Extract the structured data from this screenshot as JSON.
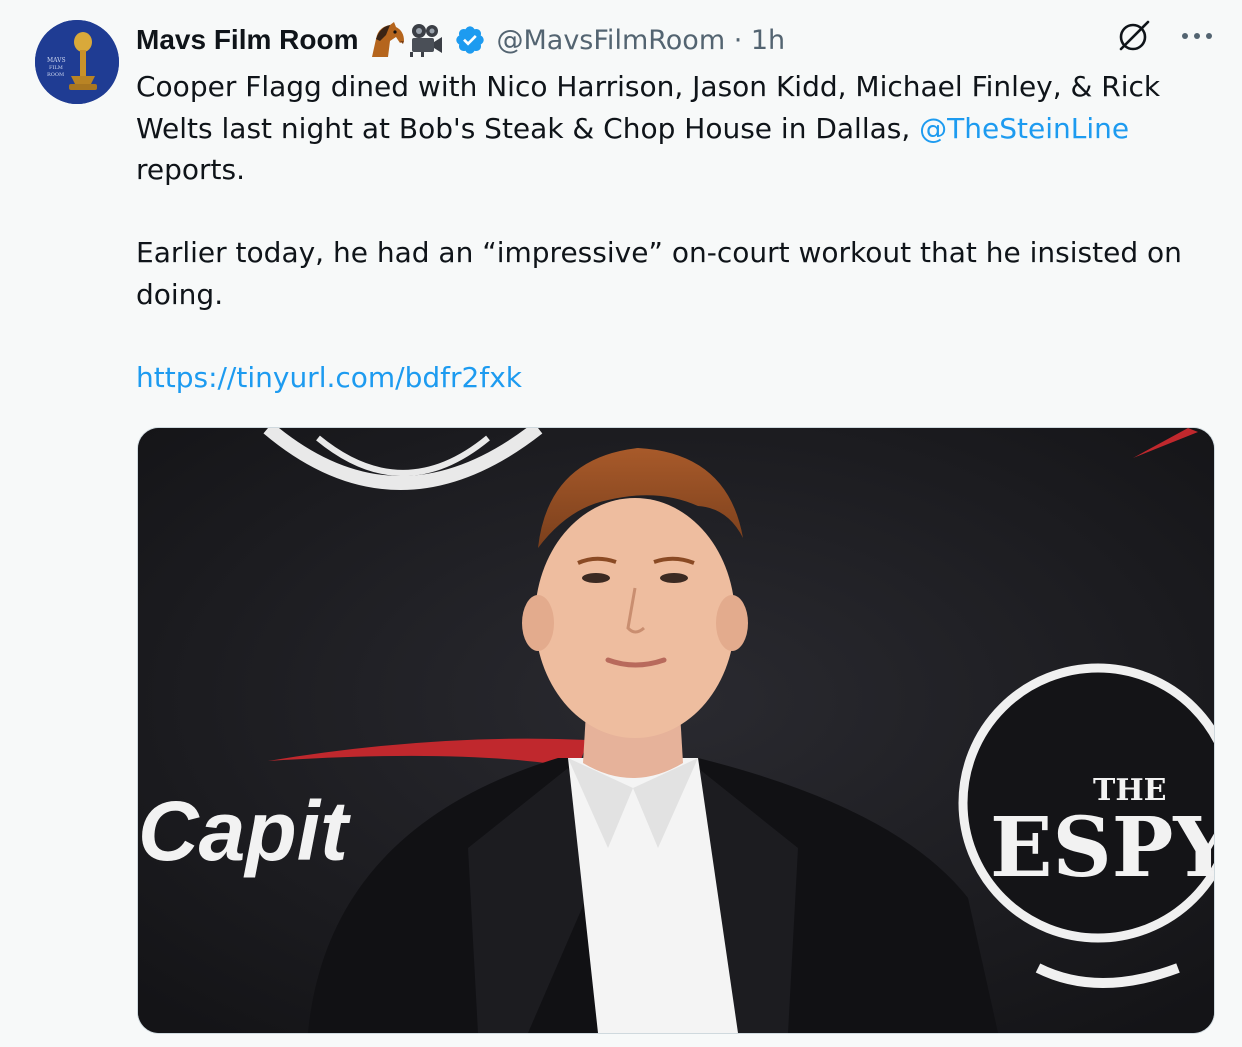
{
  "tweet": {
    "display_name": "Mavs Film Room",
    "emojis": [
      "horse-emoji-icon",
      "movie-camera-emoji-icon"
    ],
    "verified": true,
    "handle_time": "@MavsFilmRoom · 1h",
    "text": {
      "line1": "Cooper Flagg dined with Nico Harrison, Jason Kidd, Michael Finley, & Rick",
      "line2_prefix": "Welts last night at Bob's Steak & Chop House in Dallas, ",
      "mention": "@TheSteinLine",
      "line3": "reports.",
      "para2_line1": "Earlier today, he had an “impressive” on-court workout that he insisted on",
      "para2_line2": "doing.",
      "link": "https://tinyurl.com/bdfr2fxk"
    },
    "media": {
      "backdrop_text_left": "Capit",
      "logo_the": "THE",
      "logo_espys": "ESPYS"
    }
  },
  "colors": {
    "accent": "#1d9bf0",
    "secondary_text": "#536471",
    "background": "#f7f9f9"
  }
}
